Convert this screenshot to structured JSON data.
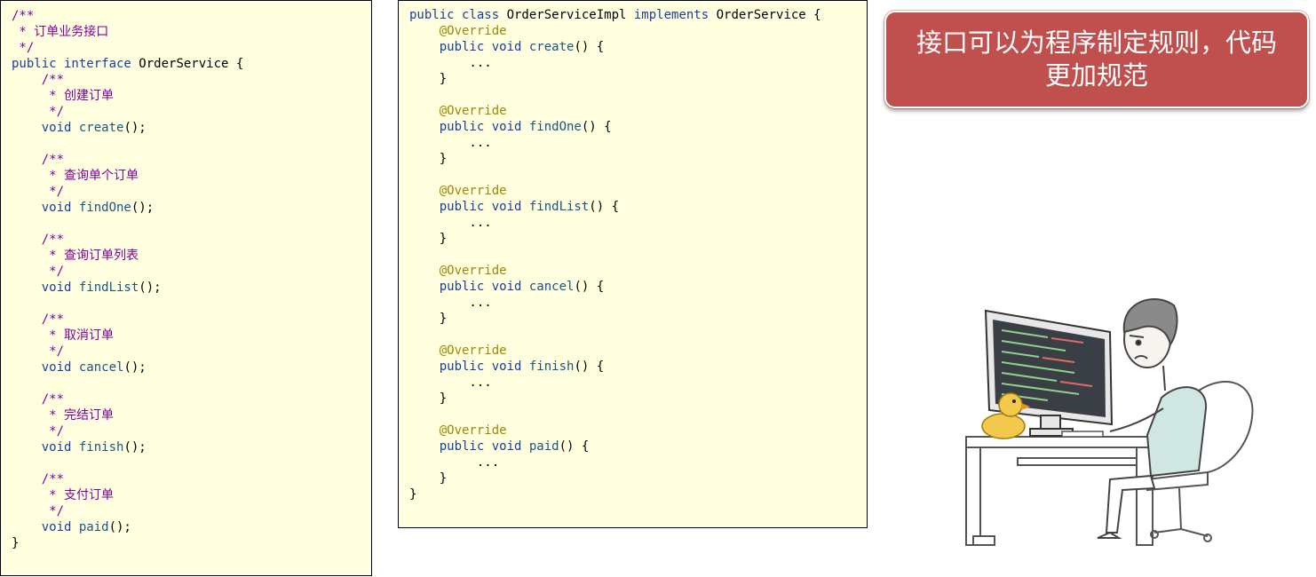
{
  "interface_panel": {
    "lines": [
      [
        [
          "comment",
          "/**"
        ]
      ],
      [
        [
          "comment",
          " * 订单业务接口"
        ]
      ],
      [
        [
          "comment",
          " */"
        ]
      ],
      [
        [
          "keyword",
          "public interface "
        ],
        [
          "plain",
          "OrderService {"
        ]
      ],
      [
        [
          "comment",
          "    /**"
        ]
      ],
      [
        [
          "comment",
          "     * 创建订单"
        ]
      ],
      [
        [
          "comment",
          "     */"
        ]
      ],
      [
        [
          "keyword",
          "    void "
        ],
        [
          "method",
          "create"
        ],
        [
          "plain",
          "();"
        ]
      ],
      [
        [
          "plain",
          ""
        ]
      ],
      [
        [
          "comment",
          "    /**"
        ]
      ],
      [
        [
          "comment",
          "     * 查询单个订单"
        ]
      ],
      [
        [
          "comment",
          "     */"
        ]
      ],
      [
        [
          "keyword",
          "    void "
        ],
        [
          "method",
          "findOne"
        ],
        [
          "plain",
          "();"
        ]
      ],
      [
        [
          "plain",
          ""
        ]
      ],
      [
        [
          "comment",
          "    /**"
        ]
      ],
      [
        [
          "comment",
          "     * 查询订单列表"
        ]
      ],
      [
        [
          "comment",
          "     */"
        ]
      ],
      [
        [
          "keyword",
          "    void "
        ],
        [
          "method",
          "findList"
        ],
        [
          "plain",
          "();"
        ]
      ],
      [
        [
          "plain",
          ""
        ]
      ],
      [
        [
          "comment",
          "    /**"
        ]
      ],
      [
        [
          "comment",
          "     * 取消订单"
        ]
      ],
      [
        [
          "comment",
          "     */"
        ]
      ],
      [
        [
          "keyword",
          "    void "
        ],
        [
          "method",
          "cancel"
        ],
        [
          "plain",
          "();"
        ]
      ],
      [
        [
          "plain",
          ""
        ]
      ],
      [
        [
          "comment",
          "    /**"
        ]
      ],
      [
        [
          "comment",
          "     * 完结订单"
        ]
      ],
      [
        [
          "comment",
          "     */"
        ]
      ],
      [
        [
          "keyword",
          "    void "
        ],
        [
          "method",
          "finish"
        ],
        [
          "plain",
          "();"
        ]
      ],
      [
        [
          "plain",
          ""
        ]
      ],
      [
        [
          "comment",
          "    /**"
        ]
      ],
      [
        [
          "comment",
          "     * 支付订单"
        ]
      ],
      [
        [
          "comment",
          "     */"
        ]
      ],
      [
        [
          "keyword",
          "    void "
        ],
        [
          "method",
          "paid"
        ],
        [
          "plain",
          "();"
        ]
      ],
      [
        [
          "plain",
          "}"
        ]
      ]
    ]
  },
  "impl_panel": {
    "lines": [
      [
        [
          "keyword",
          "public class "
        ],
        [
          "plain",
          "OrderServiceImpl "
        ],
        [
          "keyword",
          "implements "
        ],
        [
          "plain",
          "OrderService {"
        ]
      ],
      [
        [
          "annotation",
          "    @Override"
        ]
      ],
      [
        [
          "keyword",
          "    public void "
        ],
        [
          "method",
          "create"
        ],
        [
          "plain",
          "() {"
        ]
      ],
      [
        [
          "plain",
          "        ..."
        ]
      ],
      [
        [
          "plain",
          "    }"
        ]
      ],
      [
        [
          "plain",
          ""
        ]
      ],
      [
        [
          "annotation",
          "    @Override"
        ]
      ],
      [
        [
          "keyword",
          "    public void "
        ],
        [
          "method",
          "findOne"
        ],
        [
          "plain",
          "() {"
        ]
      ],
      [
        [
          "plain",
          "        ..."
        ]
      ],
      [
        [
          "plain",
          "    }"
        ]
      ],
      [
        [
          "plain",
          ""
        ]
      ],
      [
        [
          "annotation",
          "    @Override"
        ]
      ],
      [
        [
          "keyword",
          "    public void "
        ],
        [
          "method",
          "findList"
        ],
        [
          "plain",
          "() {"
        ]
      ],
      [
        [
          "plain",
          "        ..."
        ]
      ],
      [
        [
          "plain",
          "    }"
        ]
      ],
      [
        [
          "plain",
          ""
        ]
      ],
      [
        [
          "annotation",
          "    @Override"
        ]
      ],
      [
        [
          "keyword",
          "    public void "
        ],
        [
          "method",
          "cancel"
        ],
        [
          "plain",
          "() {"
        ]
      ],
      [
        [
          "plain",
          "        ..."
        ]
      ],
      [
        [
          "plain",
          "    }"
        ]
      ],
      [
        [
          "plain",
          ""
        ]
      ],
      [
        [
          "annotation",
          "    @Override"
        ]
      ],
      [
        [
          "keyword",
          "    public void "
        ],
        [
          "method",
          "finish"
        ],
        [
          "plain",
          "() {"
        ]
      ],
      [
        [
          "plain",
          "        ..."
        ]
      ],
      [
        [
          "plain",
          "    }"
        ]
      ],
      [
        [
          "plain",
          ""
        ]
      ],
      [
        [
          "annotation",
          "    @Override"
        ]
      ],
      [
        [
          "keyword",
          "    public void "
        ],
        [
          "method",
          "paid"
        ],
        [
          "plain",
          "() {"
        ]
      ],
      [
        [
          "plain",
          "         ..."
        ]
      ],
      [
        [
          "plain",
          "    }"
        ]
      ],
      [
        [
          "plain",
          "}"
        ]
      ]
    ]
  },
  "callout": {
    "line1": "接口可以为程序制定规则，代码",
    "line2": "更加规范"
  },
  "colors": {
    "code_background": "#ffffe0",
    "comment": "#8000a0",
    "keyword": "#1a3d9a",
    "annotation": "#9a8a00",
    "method": "#1a5580",
    "callout_background": "#c0504d"
  },
  "illustration": {
    "subject": "programmer-at-desk",
    "icons": [
      "monitor-icon",
      "rubber-duck-icon",
      "person-icon",
      "chair-icon",
      "desk-icon"
    ]
  }
}
